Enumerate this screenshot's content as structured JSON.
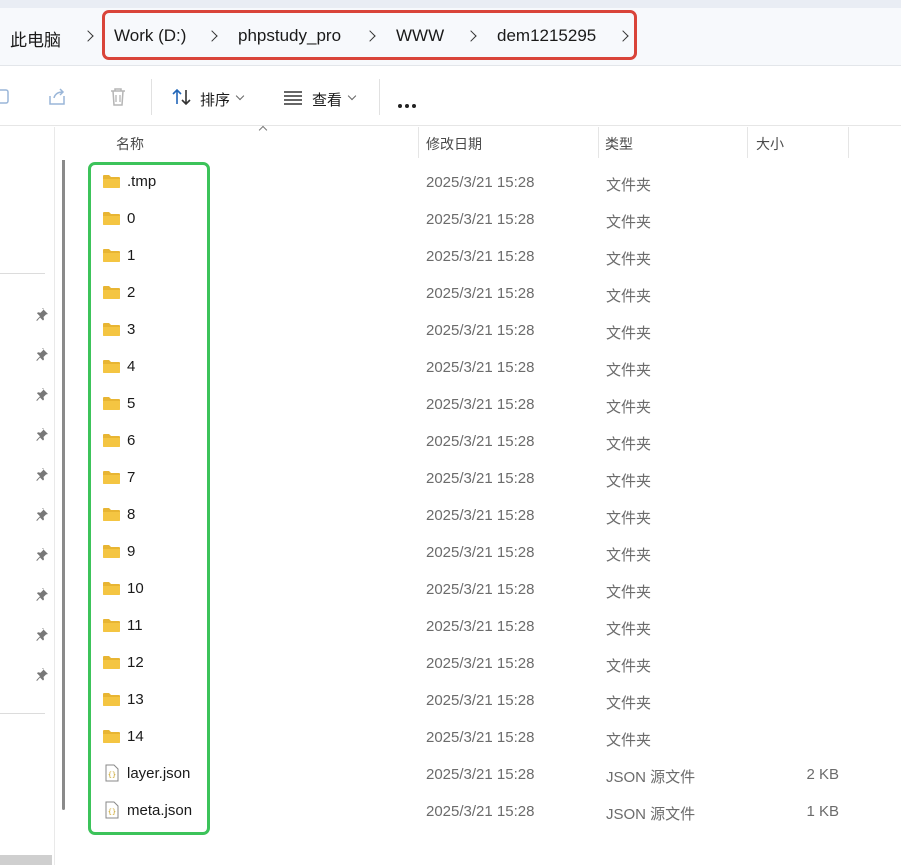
{
  "breadcrumb": {
    "items": [
      "此电脑",
      "Work (D:)",
      "phpstudy_pro",
      "WWW",
      "dem1215295"
    ]
  },
  "toolbar": {
    "sort_label": "排序",
    "view_label": "查看"
  },
  "columns": {
    "name": "名称",
    "modified": "修改日期",
    "type": "类型",
    "size": "大小"
  },
  "files": [
    {
      "name": ".tmp",
      "date": "2025/3/21 15:28",
      "type": "文件夹",
      "size": "",
      "icon": "folder-icon"
    },
    {
      "name": "0",
      "date": "2025/3/21 15:28",
      "type": "文件夹",
      "size": "",
      "icon": "folder-icon"
    },
    {
      "name": "1",
      "date": "2025/3/21 15:28",
      "type": "文件夹",
      "size": "",
      "icon": "folder-icon"
    },
    {
      "name": "2",
      "date": "2025/3/21 15:28",
      "type": "文件夹",
      "size": "",
      "icon": "folder-icon"
    },
    {
      "name": "3",
      "date": "2025/3/21 15:28",
      "type": "文件夹",
      "size": "",
      "icon": "folder-icon"
    },
    {
      "name": "4",
      "date": "2025/3/21 15:28",
      "type": "文件夹",
      "size": "",
      "icon": "folder-icon"
    },
    {
      "name": "5",
      "date": "2025/3/21 15:28",
      "type": "文件夹",
      "size": "",
      "icon": "folder-icon"
    },
    {
      "name": "6",
      "date": "2025/3/21 15:28",
      "type": "文件夹",
      "size": "",
      "icon": "folder-icon"
    },
    {
      "name": "7",
      "date": "2025/3/21 15:28",
      "type": "文件夹",
      "size": "",
      "icon": "folder-icon"
    },
    {
      "name": "8",
      "date": "2025/3/21 15:28",
      "type": "文件夹",
      "size": "",
      "icon": "folder-icon"
    },
    {
      "name": "9",
      "date": "2025/3/21 15:28",
      "type": "文件夹",
      "size": "",
      "icon": "folder-icon"
    },
    {
      "name": "10",
      "date": "2025/3/21 15:28",
      "type": "文件夹",
      "size": "",
      "icon": "folder-icon"
    },
    {
      "name": "11",
      "date": "2025/3/21 15:28",
      "type": "文件夹",
      "size": "",
      "icon": "folder-icon"
    },
    {
      "name": "12",
      "date": "2025/3/21 15:28",
      "type": "文件夹",
      "size": "",
      "icon": "folder-icon"
    },
    {
      "name": "13",
      "date": "2025/3/21 15:28",
      "type": "文件夹",
      "size": "",
      "icon": "folder-icon"
    },
    {
      "name": "14",
      "date": "2025/3/21 15:28",
      "type": "文件夹",
      "size": "",
      "icon": "folder-icon"
    },
    {
      "name": "layer.json",
      "date": "2025/3/21 15:28",
      "type": "JSON 源文件",
      "size": "2 KB",
      "icon": "json-file-icon"
    },
    {
      "name": "meta.json",
      "date": "2025/3/21 15:28",
      "type": "JSON 源文件",
      "size": "1 KB",
      "icon": "json-file-icon"
    }
  ],
  "colors": {
    "breadcrumb_highlight": "#d9443a",
    "names_highlight": "#3cc35a",
    "folder": "#f4c542"
  }
}
